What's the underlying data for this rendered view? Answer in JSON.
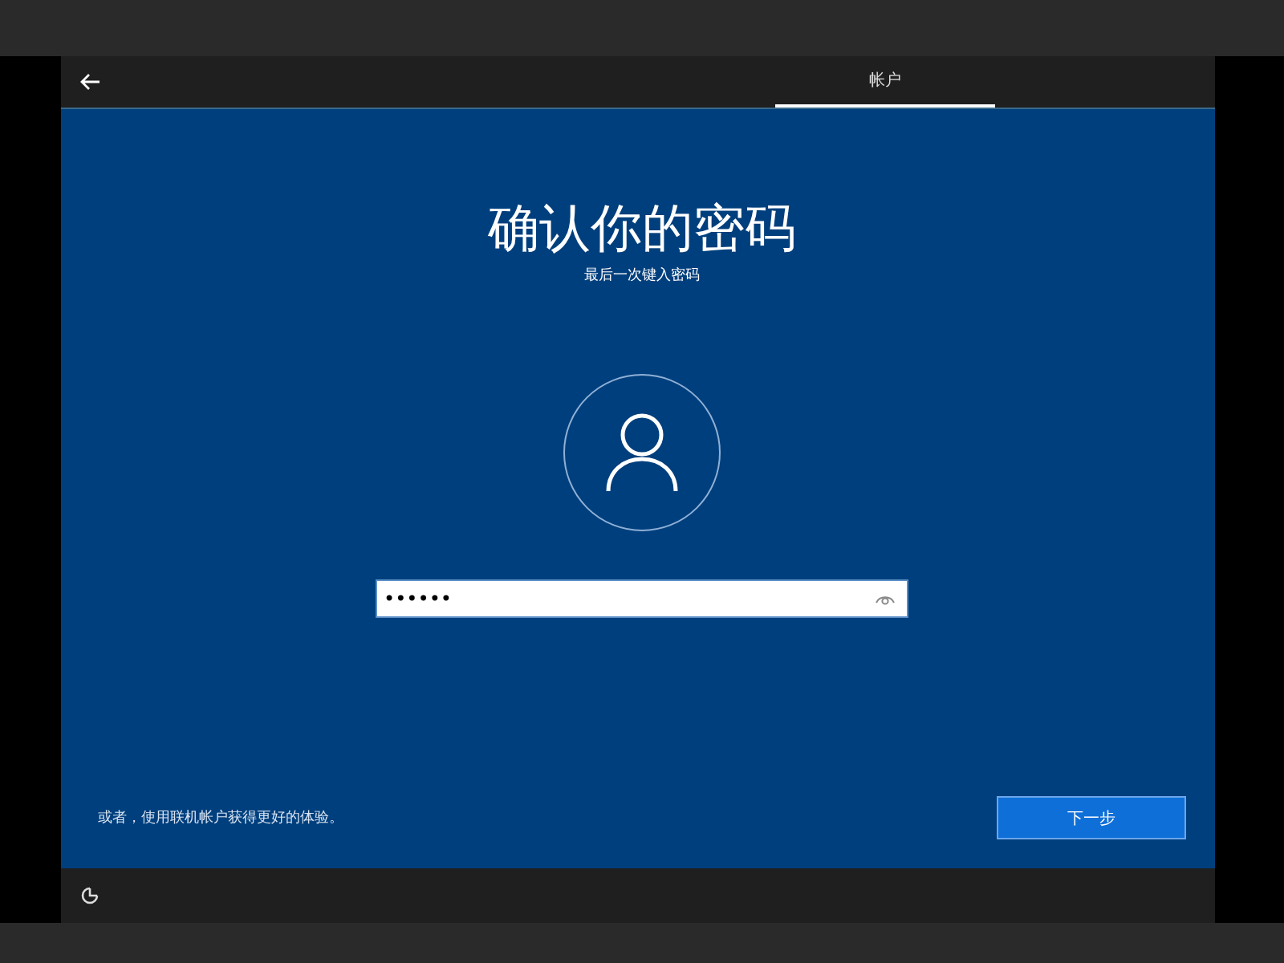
{
  "header": {
    "tabs": [
      {
        "label": "帐户",
        "selected": true
      }
    ]
  },
  "title": "确认你的密码",
  "subtitle": "最后一次键入密码",
  "password_field": {
    "value": "••••••"
  },
  "footer_note": "或者，使用联机帐户获得更好的体验。",
  "buttons": [
    {
      "label": "下一步",
      "kind": "primary"
    }
  ]
}
